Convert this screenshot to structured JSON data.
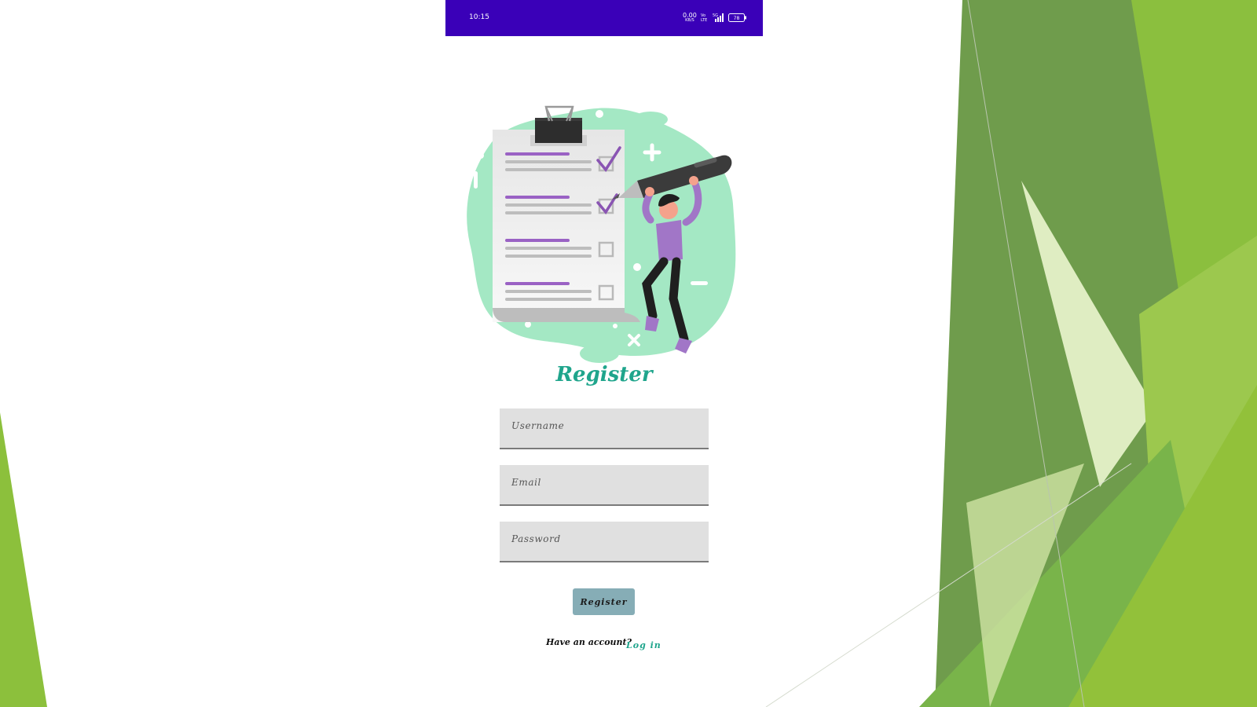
{
  "status_bar": {
    "time": "10:15",
    "net_speed_value": "0.00",
    "net_speed_unit": "KB/S",
    "network_type_top": "Vo",
    "network_type_bottom": "LTE",
    "signal_label": "5G",
    "battery_level": "78",
    "background_color": "#3a00b8"
  },
  "illustration": {
    "icon": "checklist-illustration"
  },
  "form": {
    "title": "Register",
    "username_placeholder": "Username",
    "email_placeholder": "Email",
    "password_placeholder": "Password",
    "submit_label": "Register",
    "have_account_text": "Have an account?",
    "login_link_label": "Log in",
    "accent_color": "#1fa58c",
    "button_color": "#86adb6"
  }
}
